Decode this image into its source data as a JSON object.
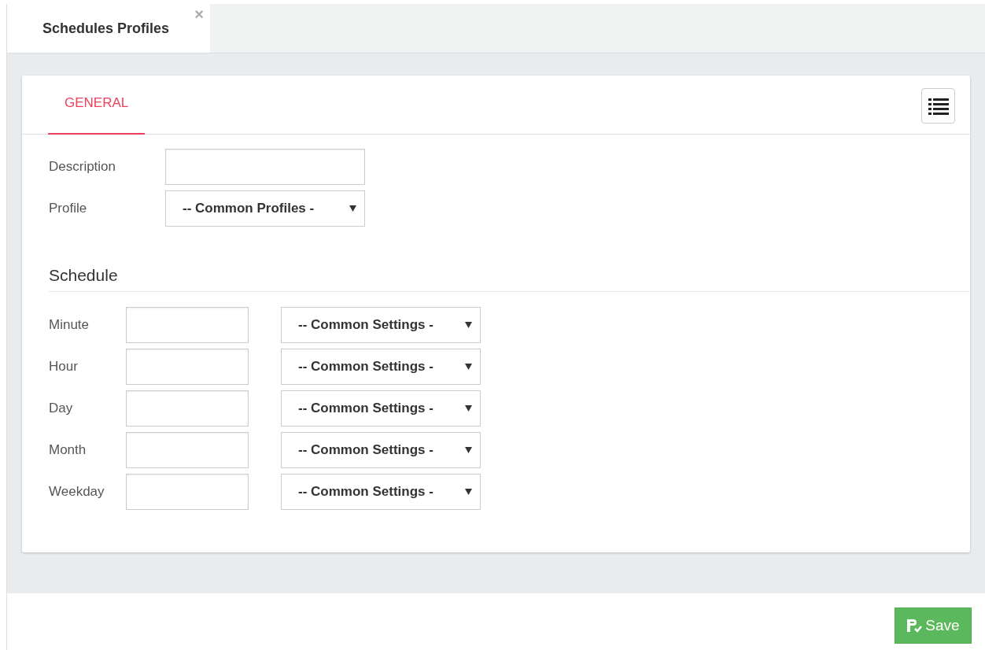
{
  "tabs": [
    {
      "label": "Schedules Profiles",
      "selected": true,
      "close": "×"
    }
  ],
  "card_tabs": [
    {
      "label": "GENERAL",
      "selected": true
    }
  ],
  "fields": [
    {
      "label": "Description",
      "kind": "text"
    },
    {
      "label": "Profile",
      "kind": "select",
      "value": "-- Common Profiles -"
    }
  ],
  "schedule": {
    "title": "Schedule",
    "rows": [
      {
        "label": "Minute",
        "setting": "-- Common Settings -"
      },
      {
        "label": "Hour",
        "setting": "-- Common Settings -"
      },
      {
        "label": "Day",
        "setting": "-- Common Settings -"
      },
      {
        "label": "Month",
        "setting": "-- Common Settings -"
      },
      {
        "label": "Weekday",
        "setting": "-- Common Settings -"
      }
    ]
  },
  "save_button": "Save"
}
